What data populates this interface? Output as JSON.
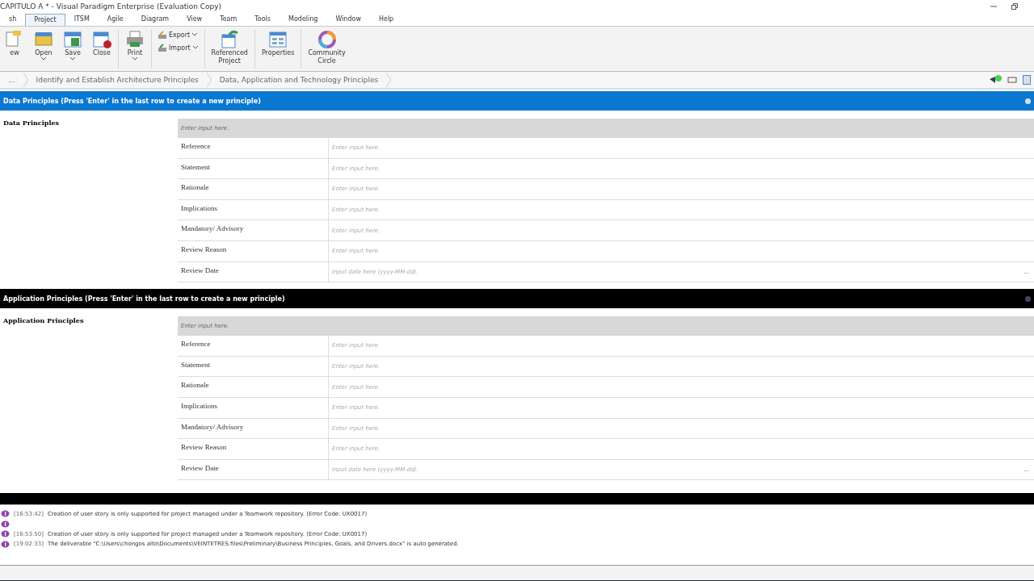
{
  "window": {
    "title": "CAPITULO A * - Visual Paradigm Enterprise (Evaluation Copy)"
  },
  "menu": [
    {
      "label": "sh",
      "selected": false
    },
    {
      "label": "Project",
      "selected": true
    },
    {
      "label": "ITSM",
      "selected": false
    },
    {
      "label": "Agile",
      "selected": false
    },
    {
      "label": "Diagram",
      "selected": false
    },
    {
      "label": "View",
      "selected": false
    },
    {
      "label": "Team",
      "selected": false
    },
    {
      "label": "Tools",
      "selected": false
    },
    {
      "label": "Modeling",
      "selected": false
    },
    {
      "label": "Window",
      "selected": false
    },
    {
      "label": "Help",
      "selected": false
    }
  ],
  "ribbon": [
    {
      "kind": "new",
      "label": "ew",
      "caret": false
    },
    {
      "kind": "open",
      "label": "Open",
      "caret": true
    },
    {
      "kind": "save",
      "label": "Save",
      "caret": true
    },
    {
      "kind": "close",
      "label": "Close",
      "caret": false
    },
    {
      "kind": "sep"
    },
    {
      "kind": "print",
      "label": "Print",
      "caret": true
    },
    {
      "kind": "sep"
    },
    {
      "kind": "pair",
      "items": [
        {
          "label": "Export"
        },
        {
          "label": "Import"
        }
      ]
    },
    {
      "kind": "sep"
    },
    {
      "kind": "referenced",
      "label": "Referenced\nProject",
      "caret": false
    },
    {
      "kind": "sep"
    },
    {
      "kind": "properties",
      "label": "Properties",
      "caret": false
    },
    {
      "kind": "sep"
    },
    {
      "kind": "circle",
      "label": "Community\nCircle",
      "caret": false
    }
  ],
  "breadcrumb": [
    "...",
    "Identify and Establish Architecture Principles",
    "Data, Application and Technology Principles"
  ],
  "sections": [
    {
      "header": "Data Principles (Press 'Enter' in the last row to create a new principle)",
      "selected": true,
      "label": "Data Principles",
      "name_placeholder": "Enter input here.",
      "rows": [
        {
          "label": "Reference",
          "placeholder": "Enter input here.",
          "kind": "text"
        },
        {
          "label": "Statement",
          "placeholder": "Enter input here.",
          "kind": "text"
        },
        {
          "label": "Rationale",
          "placeholder": "Enter input here.",
          "kind": "text"
        },
        {
          "label": "Implications",
          "placeholder": "Enter input here.",
          "kind": "text"
        },
        {
          "label": "Mandatory/ Advisory",
          "placeholder": "Enter input here.",
          "kind": "text"
        },
        {
          "label": "Review Reason",
          "placeholder": "Enter input here.",
          "kind": "text"
        },
        {
          "label": "Review Date",
          "placeholder": "Input date here (yyyy-MM-dd).",
          "kind": "date",
          "button": "..."
        }
      ]
    },
    {
      "header": "Application Principles (Press 'Enter' in the last row to create a new principle)",
      "selected": false,
      "label": "Application Principles",
      "name_placeholder": "Enter input here.",
      "rows": [
        {
          "label": "Reference",
          "placeholder": "Enter input here.",
          "kind": "text"
        },
        {
          "label": "Statement",
          "placeholder": "Enter input here.",
          "kind": "text"
        },
        {
          "label": "Rationale",
          "placeholder": "Enter input here.",
          "kind": "text"
        },
        {
          "label": "Implications",
          "placeholder": "Enter input here.",
          "kind": "text"
        },
        {
          "label": "Mandatory/ Advisory",
          "placeholder": "Enter input here.",
          "kind": "text"
        },
        {
          "label": "Review Reason",
          "placeholder": "Enter input here.",
          "kind": "text"
        },
        {
          "label": "Review Date",
          "placeholder": "Input date here (yyyy-MM-dd).",
          "kind": "date",
          "button": "..."
        }
      ]
    }
  ],
  "log": [
    {
      "kind": "message",
      "time": "[16:53:42]",
      "message": "Creation of user story is only supported for project managed under a Teamwork repository. (Error Code: UX0017)"
    },
    {
      "kind": "blank"
    },
    {
      "kind": "message",
      "time": "[16:53:50]",
      "message": "Creation of user story is only supported for project managed under a Teamwork repository. (Error Code: UX0017)"
    },
    {
      "kind": "message",
      "time": "[19:02:33]",
      "message": "The deliverable \"C:\\Users\\chongos alto\\Documents\\VEINTETRES.files\\Preliminary\\Business Principles, Goals, and Drivers.docx\" is auto generated."
    }
  ]
}
